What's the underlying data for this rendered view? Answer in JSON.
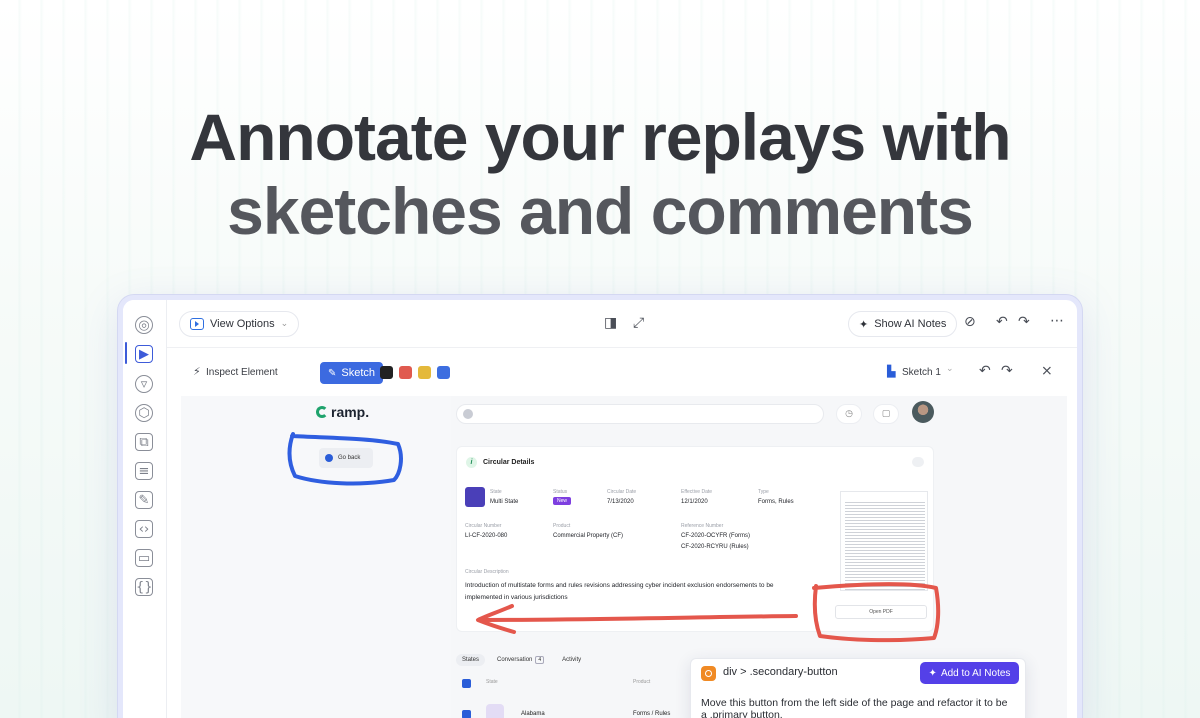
{
  "headline": {
    "line1": "Annotate your replays with",
    "line2": "sketches and comments"
  },
  "toolbar": {
    "view_options": "View Options",
    "show_ai_notes": "Show AI Notes"
  },
  "sketchbar": {
    "inspect_element": "Inspect Element",
    "sketch": "Sketch",
    "sketch_name": "Sketch 1",
    "swatches": [
      "#222222",
      "#e05a4f",
      "#e4b93b",
      "#3d6ee0"
    ]
  },
  "app": {
    "logo": "ramp.",
    "go_back": "Go back",
    "card": {
      "title": "Circular Details",
      "fields": [
        {
          "label": "State",
          "value": "Multi State"
        },
        {
          "label": "Status",
          "value": "New"
        },
        {
          "label": "Circular Date",
          "value": "7/13/2020"
        },
        {
          "label": "Effective Date",
          "value": "12/1/2020"
        },
        {
          "label": "Type",
          "value": "Forms, Rules"
        },
        {
          "label": "Circular Number",
          "value": "LI-CF-2020-080"
        },
        {
          "label": "Product",
          "value": "Commercial Property (CF)"
        },
        {
          "label": "Reference Number",
          "value": "CF-2020-OCYFR (Forms)"
        },
        {
          "label": "Reference Number 2",
          "value": "CF-2020-RCYRU (Rules)"
        }
      ],
      "description_label": "Circular Description",
      "description": "Introduction of multistate forms and rules revisions addressing cyber incident exclusion endorsements to be implemented in various jurisdictions",
      "open_pdf": "Open PDF"
    },
    "tabs": [
      {
        "label": "States"
      },
      {
        "label": "Conversation",
        "count": "4"
      },
      {
        "label": "Activity"
      }
    ],
    "table": {
      "col_state": "State",
      "col_product": "Product",
      "row1_state": "Alabama",
      "row1_product": "Forms / Rules"
    }
  },
  "comment": {
    "selector": "div > .secondary-button",
    "add_button": "Add to AI Notes",
    "text": "Move this button from the left side of the page and refactor it to be a .primary button."
  }
}
